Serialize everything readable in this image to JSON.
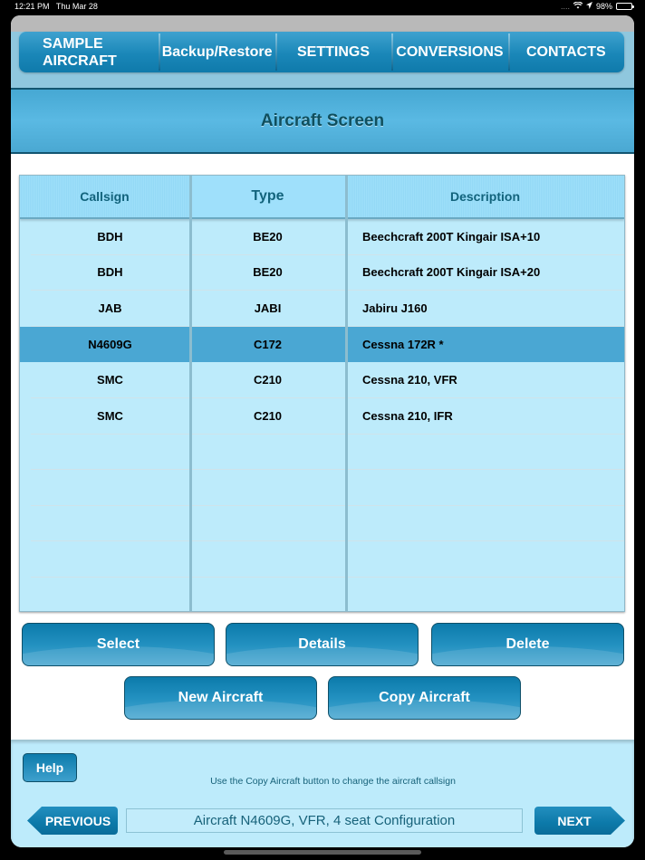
{
  "status_bar": {
    "time": "12:21 PM",
    "date": "Thu Mar 28",
    "signal": "....",
    "wifi_icon": "wifi-icon",
    "location_icon": "location-arrow-icon",
    "battery_percent": "98%",
    "battery_level": 0.98
  },
  "top_nav": {
    "items": [
      {
        "label": "SAMPLE\nAIRCRAFT",
        "line1": "SAMPLE",
        "line2": "AIRCRAFT"
      },
      {
        "label": "Backup/Restore"
      },
      {
        "label": "SETTINGS"
      },
      {
        "label": "CONVERSIONS"
      },
      {
        "label": "CONTACTS"
      }
    ]
  },
  "page": {
    "title": "Aircraft Screen"
  },
  "table": {
    "columns": [
      "Callsign",
      "Type",
      "Description"
    ],
    "rows": [
      {
        "callsign": "BDH",
        "type": "BE20",
        "description": "Beechcraft 200T Kingair ISA+10",
        "selected": false
      },
      {
        "callsign": "BDH",
        "type": "BE20",
        "description": "Beechcraft 200T Kingair ISA+20",
        "selected": false
      },
      {
        "callsign": "JAB",
        "type": "JABI",
        "description": "Jabiru J160",
        "selected": false
      },
      {
        "callsign": "N4609G",
        "type": "C172",
        "description": "Cessna 172R *",
        "selected": true
      },
      {
        "callsign": "SMC",
        "type": "C210",
        "description": "Cessna 210, VFR",
        "selected": false
      },
      {
        "callsign": "SMC",
        "type": "C210",
        "description": "Cessna 210, IFR",
        "selected": false
      }
    ],
    "empty_rows": 5
  },
  "actions": {
    "select": "Select",
    "details": "Details",
    "delete": "Delete",
    "new_aircraft": "New Aircraft",
    "copy_aircraft": "Copy Aircraft"
  },
  "footer": {
    "help": "Help",
    "hint": "Use the Copy Aircraft button to change the aircraft callsign",
    "previous": "PREVIOUS",
    "next": "NEXT",
    "current_config": "Aircraft N4609G, VFR, 4 seat Configuration"
  },
  "colors": {
    "nav_blue": "#1a87b8",
    "title_text": "#0f4f5e",
    "table_bg": "#bdebfb",
    "selected_row": "#4aa7d3",
    "header_text": "#12637c"
  }
}
